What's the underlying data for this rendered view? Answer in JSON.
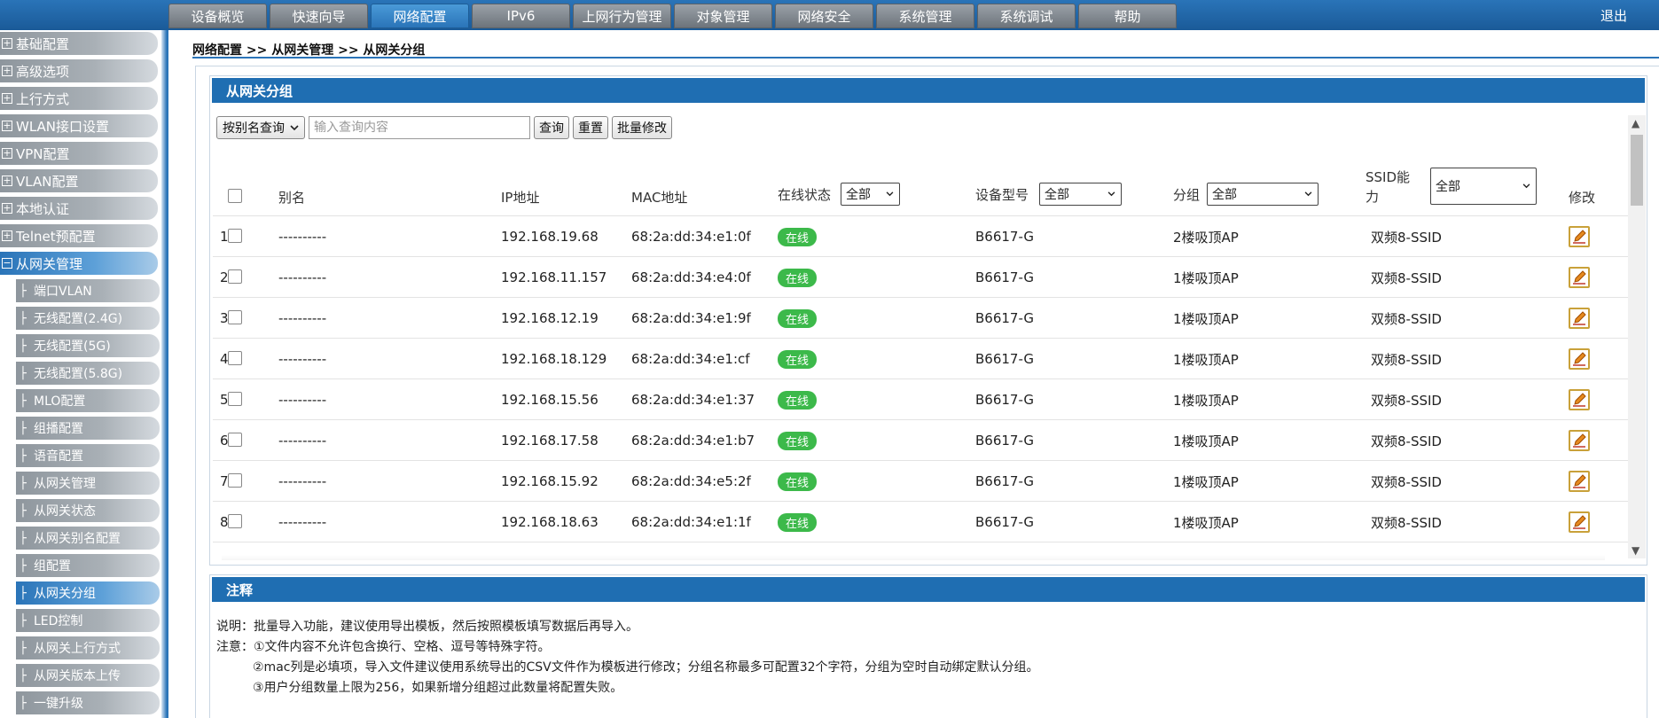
{
  "topnav": {
    "tabs": [
      "设备概览",
      "快速向导",
      "网络配置",
      "IPv6",
      "上网行为管理",
      "对象管理",
      "网络安全",
      "系统管理",
      "系统调试",
      "帮助"
    ],
    "active_tab": "网络配置",
    "logout": "退出"
  },
  "sidebar": {
    "items": [
      "基础配置",
      "高级选项",
      "上行方式",
      "WLAN接口设置",
      "VPN配置",
      "VLAN配置",
      "本地认证",
      "Telnet预配置",
      "从网关管理"
    ],
    "sub_items": [
      "端口VLAN",
      "无线配置(2.4G)",
      "无线配置(5G)",
      "无线配置(5.8G)",
      "MLO配置",
      "组播配置",
      "语音配置",
      "从网关管理",
      "从网关状态",
      "从网关别名配置",
      "组配置",
      "从网关分组",
      "LED控制",
      "从网关上行方式",
      "从网关版本上传",
      "一键升级"
    ],
    "active_sub": "从网关分组",
    "expand_symbol": "⊞",
    "collapse_symbol": "⊟"
  },
  "breadcrumb": "网络配置 >> 从网关管理 >> 从网关分组",
  "group_panel": {
    "title": "从网关分组",
    "query_mode": "按别名查询",
    "query_placeholder": "输入查询内容",
    "btn_query": "查询",
    "btn_reset": "重置",
    "btn_batch": "批量修改"
  },
  "table": {
    "headers": {
      "alias": "别名",
      "ip": "IP地址",
      "mac": "MAC地址",
      "status": "在线状态",
      "model": "设备型号",
      "group": "分组",
      "ssid_line1": "SSID能",
      "ssid_line2": "力",
      "edit": "修改"
    },
    "filters": {
      "status": "全部",
      "model": "全部",
      "group": "全部",
      "ssid": "全部"
    },
    "rows": [
      {
        "no": "1",
        "alias": "----------",
        "ip": "192.168.19.68",
        "mac": "68:2a:dd:34:e1:0f",
        "status": "在线",
        "model": "B6617-G",
        "group": "2楼吸顶AP",
        "ssid": "双频8-SSID"
      },
      {
        "no": "2",
        "alias": "----------",
        "ip": "192.168.11.157",
        "mac": "68:2a:dd:34:e4:0f",
        "status": "在线",
        "model": "B6617-G",
        "group": "1楼吸顶AP",
        "ssid": "双频8-SSID"
      },
      {
        "no": "3",
        "alias": "----------",
        "ip": "192.168.12.19",
        "mac": "68:2a:dd:34:e1:9f",
        "status": "在线",
        "model": "B6617-G",
        "group": "1楼吸顶AP",
        "ssid": "双频8-SSID"
      },
      {
        "no": "4",
        "alias": "----------",
        "ip": "192.168.18.129",
        "mac": "68:2a:dd:34:e1:cf",
        "status": "在线",
        "model": "B6617-G",
        "group": "1楼吸顶AP",
        "ssid": "双频8-SSID"
      },
      {
        "no": "5",
        "alias": "----------",
        "ip": "192.168.15.56",
        "mac": "68:2a:dd:34:e1:37",
        "status": "在线",
        "model": "B6617-G",
        "group": "1楼吸顶AP",
        "ssid": "双频8-SSID"
      },
      {
        "no": "6",
        "alias": "----------",
        "ip": "192.168.17.58",
        "mac": "68:2a:dd:34:e1:b7",
        "status": "在线",
        "model": "B6617-G",
        "group": "1楼吸顶AP",
        "ssid": "双频8-SSID"
      },
      {
        "no": "7",
        "alias": "----------",
        "ip": "192.168.15.92",
        "mac": "68:2a:dd:34:e5:2f",
        "status": "在线",
        "model": "B6617-G",
        "group": "1楼吸顶AP",
        "ssid": "双频8-SSID"
      },
      {
        "no": "8",
        "alias": "----------",
        "ip": "192.168.18.63",
        "mac": "68:2a:dd:34:e1:1f",
        "status": "在线",
        "model": "B6617-G",
        "group": "1楼吸顶AP",
        "ssid": "双频8-SSID"
      }
    ]
  },
  "notes_panel": {
    "title": "注释",
    "explain": "说明：批量导入功能，建议使用导出模板，然后按照模板填写数据后再导入。",
    "note1": "注意：①文件内容不允许包含换行、空格、逗号等特殊字符。",
    "note2": "②mac列是必填项，导入文件建议使用系统导出的CSV文件作为模板进行修改；分组名称最多可配置32个字符，分组为空时自动绑定默认分组。",
    "note3": "③用户分组数量上限为256，如果新增分组超过此数量将配置失败。"
  },
  "colors": {
    "topbar": "#1a5a98",
    "panel_header": "#1f6eb2",
    "online_badge": "#3cb94a",
    "tab_inactive": "#6d747b"
  }
}
